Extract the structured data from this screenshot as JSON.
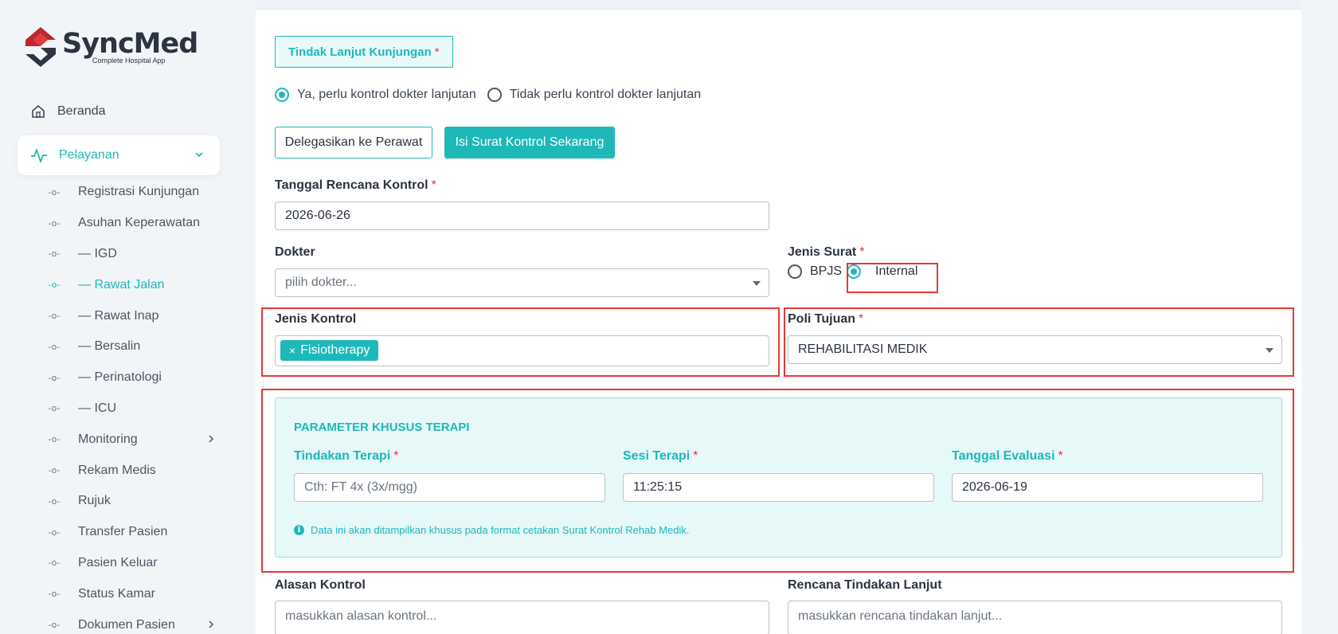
{
  "app": {
    "logo_title": "SyncMed",
    "logo_subtitle": "Complete Hospital App"
  },
  "sidebar": {
    "home_label": "Beranda",
    "active_group": "Pelayanan",
    "items": [
      {
        "label": "Registrasi Kunjungan"
      },
      {
        "label": "Asuhan Keperawatan"
      },
      {
        "label": "— IGD"
      },
      {
        "label": "— Rawat Jalan"
      },
      {
        "label": "— Rawat Inap"
      },
      {
        "label": "— Bersalin"
      },
      {
        "label": "— Perinatologi"
      },
      {
        "label": "— ICU"
      },
      {
        "label": "Monitoring"
      },
      {
        "label": "Rekam Medis"
      },
      {
        "label": "Rujuk"
      },
      {
        "label": "Transfer Pasien"
      },
      {
        "label": "Pasien Keluar"
      },
      {
        "label": "Status Kamar"
      },
      {
        "label": "Dokumen Pasien"
      }
    ],
    "active_item": "— Rawat Jalan"
  },
  "form": {
    "section_title": "Tindak Lanjut Kunjungan",
    "required_mark": "*",
    "radio_yes": "Ya, perlu kontrol dokter lanjutan",
    "radio_no": "Tidak perlu kontrol dokter lanjutan",
    "btn_delegate": "Delegasikan ke Perawat",
    "btn_fill": "Isi Surat Kontrol Sekarang",
    "tanggal_label": "Tanggal Rencana Kontrol",
    "tanggal_value": "2026-06-26",
    "dokter_label": "Dokter",
    "dokter_placeholder": "pilih dokter...",
    "jenis_surat_label": "Jenis Surat",
    "jenis_surat_bpjs": "BPJS",
    "jenis_surat_internal": "Internal",
    "jenis_kontrol_label": "Jenis Kontrol",
    "jenis_kontrol_tag_x": "×",
    "jenis_kontrol_tag": "Fisiotherapy",
    "poli_label": "Poli Tujuan",
    "poli_value": "REHABILITASI MEDIK",
    "terapi": {
      "title": "PARAMETER KHUSUS TERAPI",
      "tindakan_label": "Tindakan Terapi",
      "tindakan_placeholder": "Cth: FT 4x (3x/mgg)",
      "sesi_label": "Sesi Terapi",
      "sesi_value": "11:25:15",
      "evaluasi_label": "Tanggal Evaluasi",
      "evaluasi_value": "2026-06-19",
      "note_icon": "i",
      "note": "Data ini akan ditampilkan khusus pada format cetakan Surat Kontrol Rehab Medik."
    },
    "alasan_label": "Alasan Kontrol",
    "alasan_placeholder": "masukkan alasan kontrol...",
    "rencana_label": "Rencana Tindakan Lanjut",
    "rencana_placeholder": "masukkan rencana tindakan lanjut..."
  },
  "colors": {
    "accent": "#1fb8b8",
    "required": "#e5334b",
    "highlight_box": "#e53935"
  }
}
